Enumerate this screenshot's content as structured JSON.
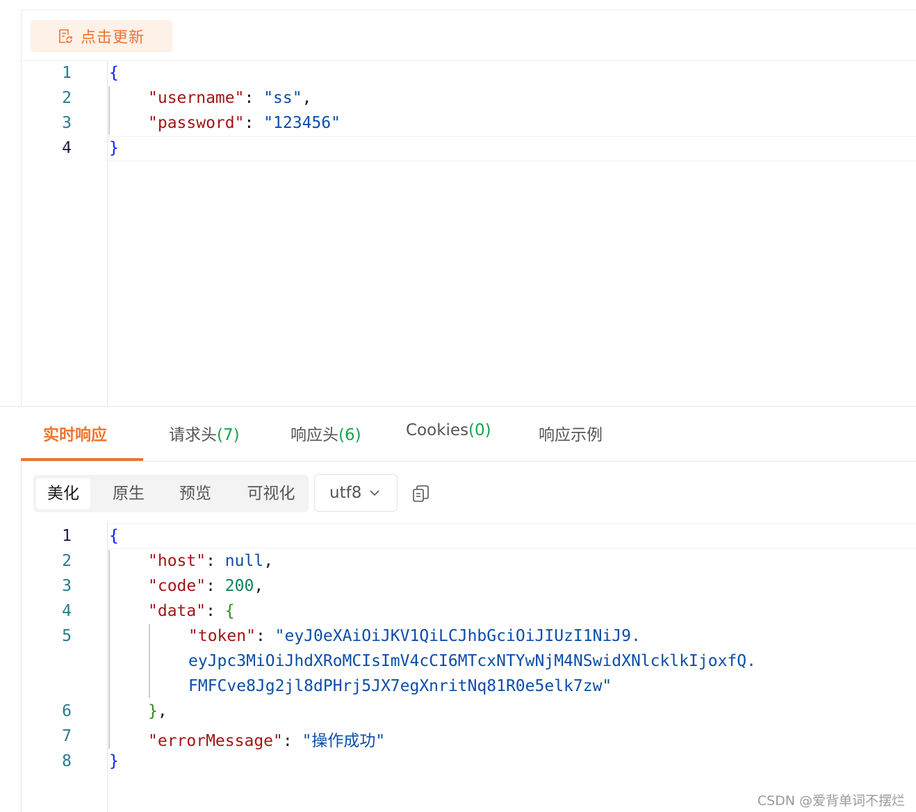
{
  "request": {
    "refresh_label": "点击更新",
    "body": {
      "line_numbers": [
        "1",
        "2",
        "3",
        "4"
      ],
      "username_key": "\"username\"",
      "username_value": "\"ss\"",
      "password_key": "\"password\"",
      "password_value": "\"123456\""
    }
  },
  "tabs": [
    {
      "label": "实时响应",
      "count": ""
    },
    {
      "label": "请求头",
      "count": "(7)"
    },
    {
      "label": "响应头",
      "count": "(6)"
    },
    {
      "label": "Cookies",
      "count": "(0)"
    },
    {
      "label": "响应示例",
      "count": ""
    }
  ],
  "toolbar": {
    "format_options": [
      "美化",
      "原生",
      "预览",
      "可视化"
    ],
    "encoding": "utf8"
  },
  "response": {
    "line_numbers": [
      "1",
      "2",
      "3",
      "4",
      "5",
      "6",
      "7",
      "8"
    ],
    "host_key": "\"host\"",
    "host_value": "null",
    "code_key": "\"code\"",
    "code_value": "200",
    "data_key": "\"data\"",
    "token_key": "\"token\"",
    "token_line1": "\"eyJ0eXAiOiJKV1QiLCJhbGciOiJIUzI1NiJ9.",
    "token_line2": "eyJpc3MiOiJhdXRoMCIsImV4cCI6MTcxNTYwNjM4NSwidXNlcklkIjoxfQ.",
    "token_line3": "FMFCve8Jg2jl8dPHrj5JX7egXnritNq81R0e5elk7zw\"",
    "error_key": "\"errorMessage\"",
    "error_value": "\"操作成功\""
  },
  "watermark": "CSDN @爱背单词不摆烂"
}
